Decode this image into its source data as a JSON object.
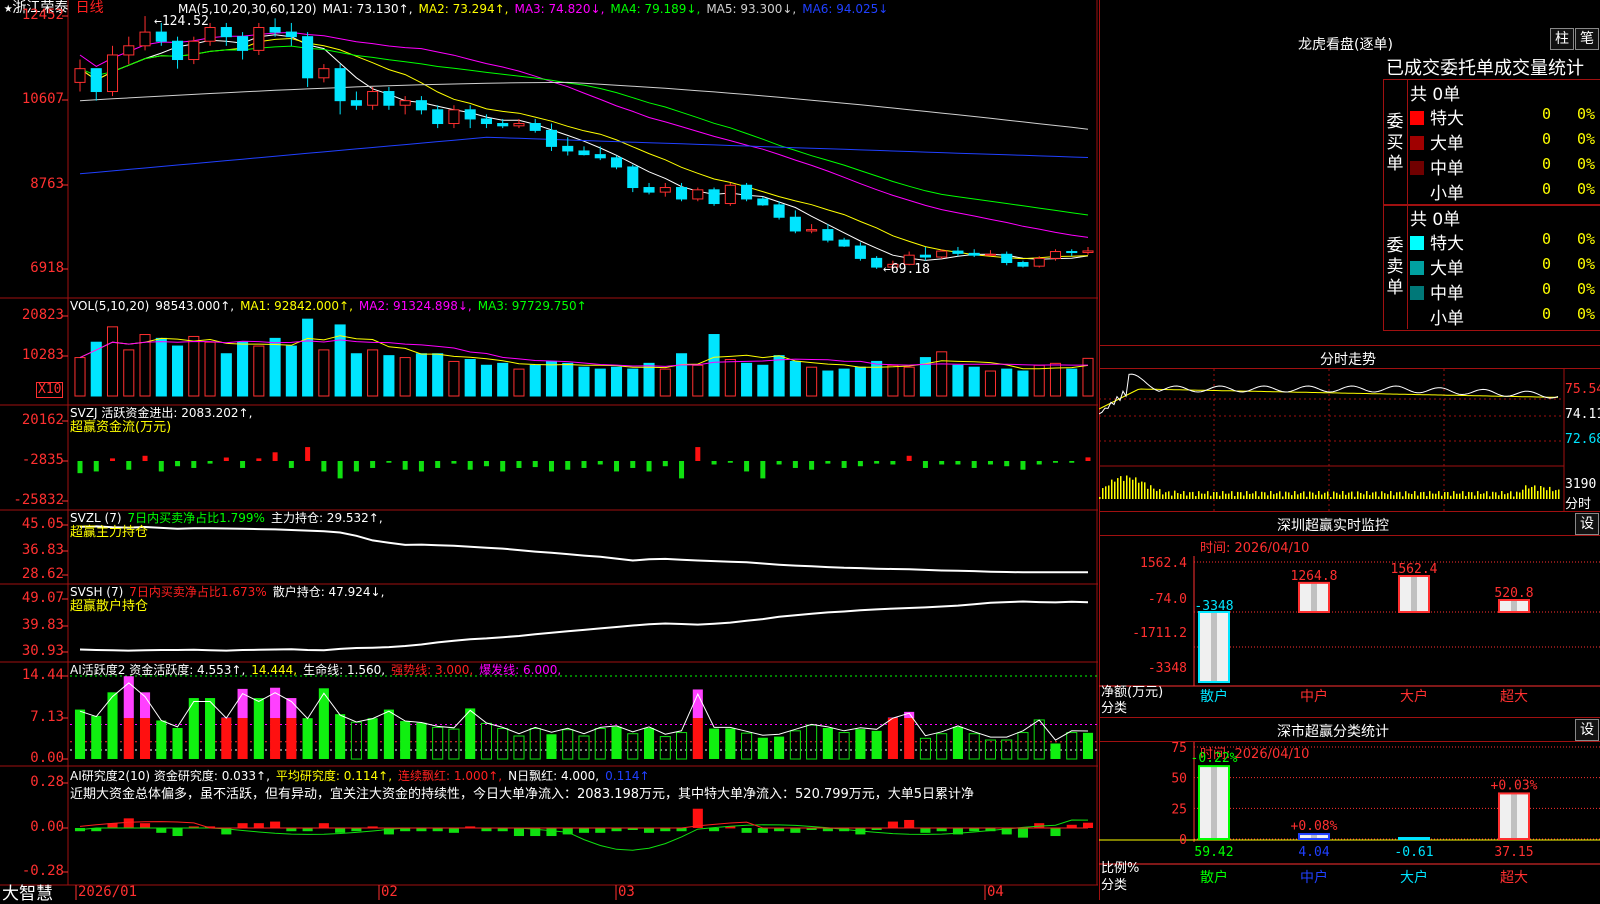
{
  "stock": {
    "name": "★浙江荣泰",
    "period": "日线"
  },
  "main_header": [
    {
      "t": "MA(5,10,20,30,60,120)",
      "c": "#ffffff"
    },
    {
      "t": "MA1: 73.130↑,",
      "c": "#ffffff"
    },
    {
      "t": "MA2: 73.294↑,",
      "c": "#ffff00"
    },
    {
      "t": "MA3: 74.820↓,",
      "c": "#ff00ff"
    },
    {
      "t": "MA4: 79.189↓,",
      "c": "#00ff00"
    },
    {
      "t": "MA5: 93.300↓,",
      "c": "#d0d0d0"
    },
    {
      "t": "MA6: 94.025↓",
      "c": "#2040ff"
    }
  ],
  "main_axis": [
    "12452",
    "10607",
    "8763",
    "6918"
  ],
  "main_annotations": {
    "high": "124.52",
    "low": "69.18"
  },
  "vol_header": [
    {
      "t": "VOL(5,10,20)",
      "c": "#ffffff"
    },
    {
      "t": "98543.000↑,",
      "c": "#ffffff"
    },
    {
      "t": "MA1: 92842.000↑,",
      "c": "#ffff00"
    },
    {
      "t": "MA2: 91324.898↓,",
      "c": "#ff00ff"
    },
    {
      "t": "MA3: 97729.750↑",
      "c": "#00ff00"
    }
  ],
  "vol_axis": [
    "20823",
    "10283"
  ],
  "vol_unit": "X10",
  "svzj_header": [
    {
      "t": "SVZJ  活跃资金进出: 2083.202↑,",
      "c": "#ffffff"
    }
  ],
  "svzj_sub": "超赢资金流(万元)",
  "svzj_axis": [
    "20162",
    "-2835",
    "-25832"
  ],
  "svzl_header": [
    {
      "t": "SVZL (7)",
      "c": "#ffffff"
    },
    {
      "t": "7日内买卖净占比1.799%",
      "c": "#00ff00"
    },
    {
      "t": "主力持仓: 29.532↑,",
      "c": "#ffffff"
    }
  ],
  "svzl_sub": "超赢主力持仓",
  "svzl_axis": [
    "45.05",
    "36.83",
    "28.62"
  ],
  "svsh_header": [
    {
      "t": "SVSH (7)",
      "c": "#ffffff"
    },
    {
      "t": "7日内买卖净占比1.673%",
      "c": "#ff2020"
    },
    {
      "t": "散户持仓: 47.924↓,",
      "c": "#ffffff"
    }
  ],
  "svsh_sub": "超赢散户持仓",
  "svsh_axis": [
    "49.07",
    "39.83",
    "30.93"
  ],
  "ai1_header": [
    {
      "t": "AI活跃度2 资金活跃度: 4.553↑,",
      "c": "#ffffff"
    },
    {
      "t": "14.444,",
      "c": "#ffff00"
    },
    {
      "t": "生命线: 1.560,",
      "c": "#ffffff"
    },
    {
      "t": "强势线: 3.000,",
      "c": "#ff2020"
    },
    {
      "t": "爆发线: 6.000,",
      "c": "#ff00ff"
    }
  ],
  "ai1_axis": [
    "14.44",
    "7.13",
    "0.00"
  ],
  "ai2_header": [
    {
      "t": "AI研究度2(10) 资金研究度: 0.033↑,",
      "c": "#ffffff"
    },
    {
      "t": "平均研究度: 0.114↑,",
      "c": "#ffff00"
    },
    {
      "t": "连续飘红: 1.000↑,",
      "c": "#ff2020"
    },
    {
      "t": "N日飘红: 4.000,",
      "c": "#ffffff"
    },
    {
      "t": "0.114↑",
      "c": "#2040ff"
    }
  ],
  "ai2_text": "近期大资金总体偏多，虽不活跃，但有异动，宜关注大资金的持续性，今日大单净流入：2083.198万元，其中特大单净流入：520.799万元，大单5日累计净",
  "ai2_axis": [
    "0.28",
    "0.00",
    "-0.28"
  ],
  "x_axis": [
    "2026/01",
    "02",
    "03",
    "04"
  ],
  "brand": "大智慧",
  "right": {
    "title": "龙虎看盘(逐单)",
    "btn1": "柱",
    "btn2": "笔",
    "stats_title": "已成交委托单成交量统计",
    "buy_label": "委买单",
    "sell_label": "委卖单",
    "buy_total": "共 0单",
    "sell_total": "共 0单",
    "buy_rows": [
      {
        "label": "特大",
        "n": "0",
        "p": "0%",
        "color": "#ff0000"
      },
      {
        "label": "大单",
        "n": "0",
        "p": "0%",
        "color": "#a00000"
      },
      {
        "label": "中单",
        "n": "0",
        "p": "0%",
        "color": "#700000"
      },
      {
        "label": "小单",
        "n": "0",
        "p": "0%",
        "color": "#000000"
      }
    ],
    "sell_rows": [
      {
        "label": "特大",
        "n": "0",
        "p": "0%",
        "color": "#00ffff"
      },
      {
        "label": "大单",
        "n": "0",
        "p": "0%",
        "color": "#00a0a0"
      },
      {
        "label": "中单",
        "n": "0",
        "p": "0%",
        "color": "#007878"
      },
      {
        "label": "小单",
        "n": "0",
        "p": "0%",
        "color": "#000000"
      }
    ],
    "intraday_title": "分时走势",
    "intraday_axis": [
      "75.54",
      "74.11",
      "72.68"
    ],
    "intraday_vol": "3190",
    "intraday_vol_label": "分时",
    "monitor_title": "深圳超赢实时监控",
    "monitor_time": "时间: 2026/04/10",
    "monitor_axis": [
      "1562.4",
      "-74.0",
      "-1711.2",
      "-3348"
    ],
    "monitor_ylabel": "净额(万元)",
    "monitor_xlabel": "分类",
    "classify_title": "深市超赢分类统计",
    "classify_time": "时间: 2026/04/10",
    "classify_axis": [
      "75",
      "50",
      "25",
      "0"
    ],
    "classify_ylabel": "比例%",
    "classify_xlabel": "分类",
    "set_btn": "设"
  },
  "chart_data": [
    {
      "type": "candlestick",
      "title": "浙江荣泰 日线",
      "ylim": [
        69.18,
        124.52
      ],
      "ohlc": [
        [
          110,
          115,
          108,
          113
        ],
        [
          113,
          112,
          106,
          108
        ],
        [
          108,
          118,
          107,
          116
        ],
        [
          116,
          120,
          114,
          118
        ],
        [
          118,
          124.5,
          117,
          121
        ],
        [
          121,
          123,
          118,
          119
        ],
        [
          119,
          120,
          113,
          115
        ],
        [
          115,
          120,
          114,
          119
        ],
        [
          119,
          123,
          118,
          122
        ],
        [
          122,
          123,
          118,
          120
        ],
        [
          120,
          121,
          115,
          117
        ],
        [
          117,
          123,
          116,
          122
        ],
        [
          122,
          124,
          120,
          121
        ],
        [
          121,
          123,
          118,
          120
        ],
        [
          120,
          121,
          109,
          111
        ],
        [
          111,
          114,
          110,
          113
        ],
        [
          113,
          114,
          103,
          106
        ],
        [
          106,
          108,
          104,
          105
        ],
        [
          105,
          109,
          104,
          108
        ],
        [
          108,
          109,
          104,
          105
        ],
        [
          105,
          107,
          103,
          106
        ],
        [
          106,
          107,
          103,
          104
        ],
        [
          104,
          105,
          100,
          101
        ],
        [
          101,
          105,
          100,
          104
        ],
        [
          104,
          105,
          100,
          102
        ],
        [
          102,
          103,
          100,
          101
        ],
        [
          101,
          102,
          100,
          100.5
        ],
        [
          100.5,
          102,
          100,
          101
        ],
        [
          101,
          102,
          99,
          99.5
        ],
        [
          99.5,
          101,
          95,
          96
        ],
        [
          96,
          98,
          94,
          95
        ],
        [
          95,
          96,
          94,
          94.2
        ],
        [
          94.2,
          96,
          93,
          93.5
        ],
        [
          93.5,
          94,
          91,
          91.5
        ],
        [
          91.5,
          92,
          86,
          87
        ],
        [
          87,
          88,
          85.5,
          86
        ],
        [
          86,
          88,
          85,
          87
        ],
        [
          87,
          88,
          84,
          84.5
        ],
        [
          84.5,
          87,
          84,
          86.5
        ],
        [
          86.5,
          87,
          83,
          83.5
        ],
        [
          83.5,
          88,
          83,
          87.5
        ],
        [
          87.5,
          88,
          84,
          84.5
        ],
        [
          84.5,
          85,
          83,
          83.2
        ],
        [
          83.2,
          84,
          80,
          80.5
        ],
        [
          80.5,
          82,
          77,
          77.5
        ],
        [
          77.5,
          79,
          77,
          77.8
        ],
        [
          77.8,
          79,
          75,
          75.5
        ],
        [
          75.5,
          76,
          74,
          74.2
        ],
        [
          74.2,
          75,
          71,
          71.5
        ],
        [
          71.5,
          72,
          69.2,
          69.6
        ],
        [
          69.6,
          71,
          69.18,
          70.2
        ],
        [
          70.2,
          73,
          70,
          72.2
        ],
        [
          72.2,
          74,
          71,
          71.8
        ],
        [
          71.8,
          73.5,
          71.4,
          73.1
        ],
        [
          73.1,
          74,
          72,
          72.6
        ],
        [
          72.6,
          73.5,
          71.8,
          72.2
        ],
        [
          72.2,
          73.3,
          72,
          72.4
        ],
        [
          72.4,
          73,
          70,
          70.6
        ],
        [
          70.6,
          71,
          69.5,
          69.8
        ],
        [
          69.8,
          72,
          69.5,
          71.5
        ],
        [
          71.5,
          73.5,
          71,
          73.0
        ],
        [
          73.0,
          73.5,
          72,
          72.8
        ],
        [
          72.8,
          74,
          72.3,
          73.13
        ]
      ]
    },
    {
      "type": "bar",
      "title": "VOL",
      "ylim": [
        0,
        20823
      ],
      "values": [
        10000,
        14000,
        18000,
        12000,
        16000,
        15000,
        13000,
        15500,
        14000,
        11000,
        14000,
        13000,
        15000,
        13000,
        20000,
        12000,
        18500,
        11000,
        12000,
        10500,
        10000,
        11000,
        11000,
        9000,
        9500,
        8000,
        8500,
        7000,
        8000,
        9000,
        8500,
        7500,
        7000,
        7500,
        7000,
        8500,
        7000,
        11000,
        8000,
        16000,
        9500,
        8500,
        8000,
        10500,
        9000,
        7500,
        6500,
        7000,
        7500,
        9000,
        8000,
        7500,
        10000,
        11500,
        8000,
        7500,
        6500,
        7000,
        6500,
        8000,
        8500,
        7000,
        9800
      ]
    },
    {
      "type": "bar",
      "title": "SVZJ 活跃资金进出",
      "ylim": [
        -25832,
        20162
      ],
      "values": [
        -7000,
        -6000,
        1500,
        -5000,
        3000,
        -6000,
        -3000,
        -4000,
        -1500,
        2000,
        -4000,
        1500,
        5000,
        -4000,
        8000,
        -6000,
        -10000,
        -6000,
        -4000,
        -1000,
        -5000,
        -6000,
        -4000,
        -1500,
        -5000,
        -3000,
        -6000,
        -4000,
        -3500,
        -6000,
        -5000,
        -4000,
        -2000,
        -6000,
        -4000,
        -6000,
        -3000,
        -10000,
        8000,
        -2000,
        -1000,
        -6000,
        -10000,
        -2000,
        -4000,
        -5000,
        -1500,
        -4000,
        -3000,
        -1500,
        -2000,
        3000,
        -4000,
        -2000,
        -2000,
        -4000,
        -2000,
        -3000,
        -5000,
        -2000,
        -1000,
        -1000,
        2083
      ]
    },
    {
      "type": "line",
      "title": "SVZL 主力持仓",
      "ylim": [
        28.62,
        45.05
      ],
      "values": [
        44.5,
        44.6,
        44.3,
        44.2,
        44.4,
        44.1,
        43.8,
        44.0,
        44.0,
        43.9,
        43.8,
        43.7,
        43.6,
        43.4,
        43.2,
        43.0,
        42.6,
        41.5,
        40.0,
        39.2,
        38.5,
        38.6,
        38.4,
        38.2,
        37.9,
        37.6,
        37.3,
        36.8,
        36.3,
        35.9,
        35.5,
        35.0,
        34.6,
        34.0,
        33.4,
        33.8,
        33.9,
        33.6,
        33.4,
        33.2,
        33.0,
        32.8,
        32.4,
        32.0,
        31.7,
        31.5,
        31.2,
        31.0,
        30.9,
        30.7,
        30.6,
        30.5,
        30.3,
        30.1,
        30.0,
        29.9,
        29.7,
        29.6,
        29.5,
        29.5,
        29.5,
        29.5,
        29.532
      ]
    },
    {
      "type": "line",
      "title": "SVSH 散户持仓",
      "ylim": [
        30.93,
        49.07
      ],
      "values": [
        31.8,
        31.6,
        31.5,
        31.4,
        31.5,
        31.6,
        31.6,
        31.7,
        31.5,
        31.4,
        31.6,
        31.7,
        31.8,
        31.9,
        31.6,
        31.5,
        32.0,
        32.3,
        32.4,
        32.6,
        33.0,
        33.5,
        34.2,
        34.8,
        35.3,
        35.6,
        36.0,
        36.4,
        37.0,
        37.5,
        38.0,
        38.5,
        39.0,
        39.5,
        40.0,
        40.4,
        40.7,
        40.5,
        40.3,
        40.6,
        41.0,
        41.6,
        42.2,
        43.0,
        43.5,
        44.0,
        44.5,
        44.8,
        45.2,
        45.5,
        45.8,
        46.0,
        46.2,
        46.5,
        46.8,
        47.3,
        47.8,
        48.0,
        48.2,
        48.0,
        47.9,
        48.1,
        47.924
      ]
    },
    {
      "type": "bar",
      "title": "AI活跃度2",
      "ylim": [
        0,
        14.44
      ],
      "values": [
        8.6,
        7.5,
        11.6,
        14.4,
        11.6,
        6.7,
        5.4,
        10.6,
        10.6,
        7.2,
        12.2,
        10.6,
        12.4,
        10.6,
        7.1,
        12.3,
        7.8,
        6.4,
        7.1,
        8.6,
        6.6,
        6.3,
        5.5,
        5.2,
        8.8,
        6.2,
        5.3,
        4.0,
        5.3,
        4.3,
        5.1,
        4.0,
        5.3,
        5.6,
        4.4,
        5.4,
        3.9,
        4.6,
        12.1,
        5.3,
        5.3,
        4.5,
        3.7,
        3.9,
        4.9,
        5.9,
        5.4,
        4.6,
        5.2,
        4.9,
        7.2,
        8.2,
        3.6,
        4.4,
        5.6,
        4.4,
        3.3,
        3.3,
        4.6,
        6.8,
        2.7,
        4.6,
        4.553
      ],
      "life_line": 1.56,
      "strong_line": 3.0,
      "burst_line": 6.0
    },
    {
      "type": "bar",
      "title": "AI研究度2",
      "ylim": [
        -0.28,
        0.28
      ],
      "values": [
        -0.02,
        -0.02,
        0.03,
        0.06,
        0.03,
        -0.03,
        -0.05,
        0.01,
        0.01,
        -0.04,
        0.03,
        0.03,
        0.04,
        -0.02,
        -0.02,
        0.03,
        -0.03,
        -0.02,
        0.01,
        -0.04,
        -0.02,
        -0.02,
        -0.02,
        -0.03,
        0.01,
        -0.02,
        -0.02,
        -0.05,
        -0.05,
        -0.05,
        -0.04,
        -0.03,
        -0.03,
        -0.02,
        -0.01,
        -0.03,
        -0.02,
        -0.02,
        0.12,
        -0.02,
        0.01,
        -0.03,
        -0.03,
        -0.02,
        -0.03,
        -0.01,
        -0.02,
        -0.02,
        -0.04,
        -0.01,
        0.04,
        0.05,
        -0.03,
        -0.02,
        -0.04,
        -0.02,
        -0.02,
        -0.04,
        -0.06,
        0.03,
        -0.05,
        0.02,
        0.033
      ]
    },
    {
      "type": "bar",
      "title": "深圳超赢实时监控",
      "categories": [
        "散户",
        "中户",
        "大户",
        "超大"
      ],
      "values": [
        -3348,
        1264.8,
        1562.4,
        520.8
      ],
      "ylim": [
        -3348,
        1562.4
      ]
    },
    {
      "type": "bar",
      "title": "深市超赢分类统计",
      "categories": [
        "散户",
        "中户",
        "大户",
        "超大"
      ],
      "values": [
        59.42,
        4.04,
        -0.61,
        37.15
      ],
      "changes": [
        "-0.22%",
        "+0.08%",
        "",
        "+0.03%"
      ],
      "ylim": [
        0,
        75
      ]
    },
    {
      "type": "line",
      "title": "分时走势",
      "ylim": [
        72.68,
        75.54
      ]
    }
  ]
}
